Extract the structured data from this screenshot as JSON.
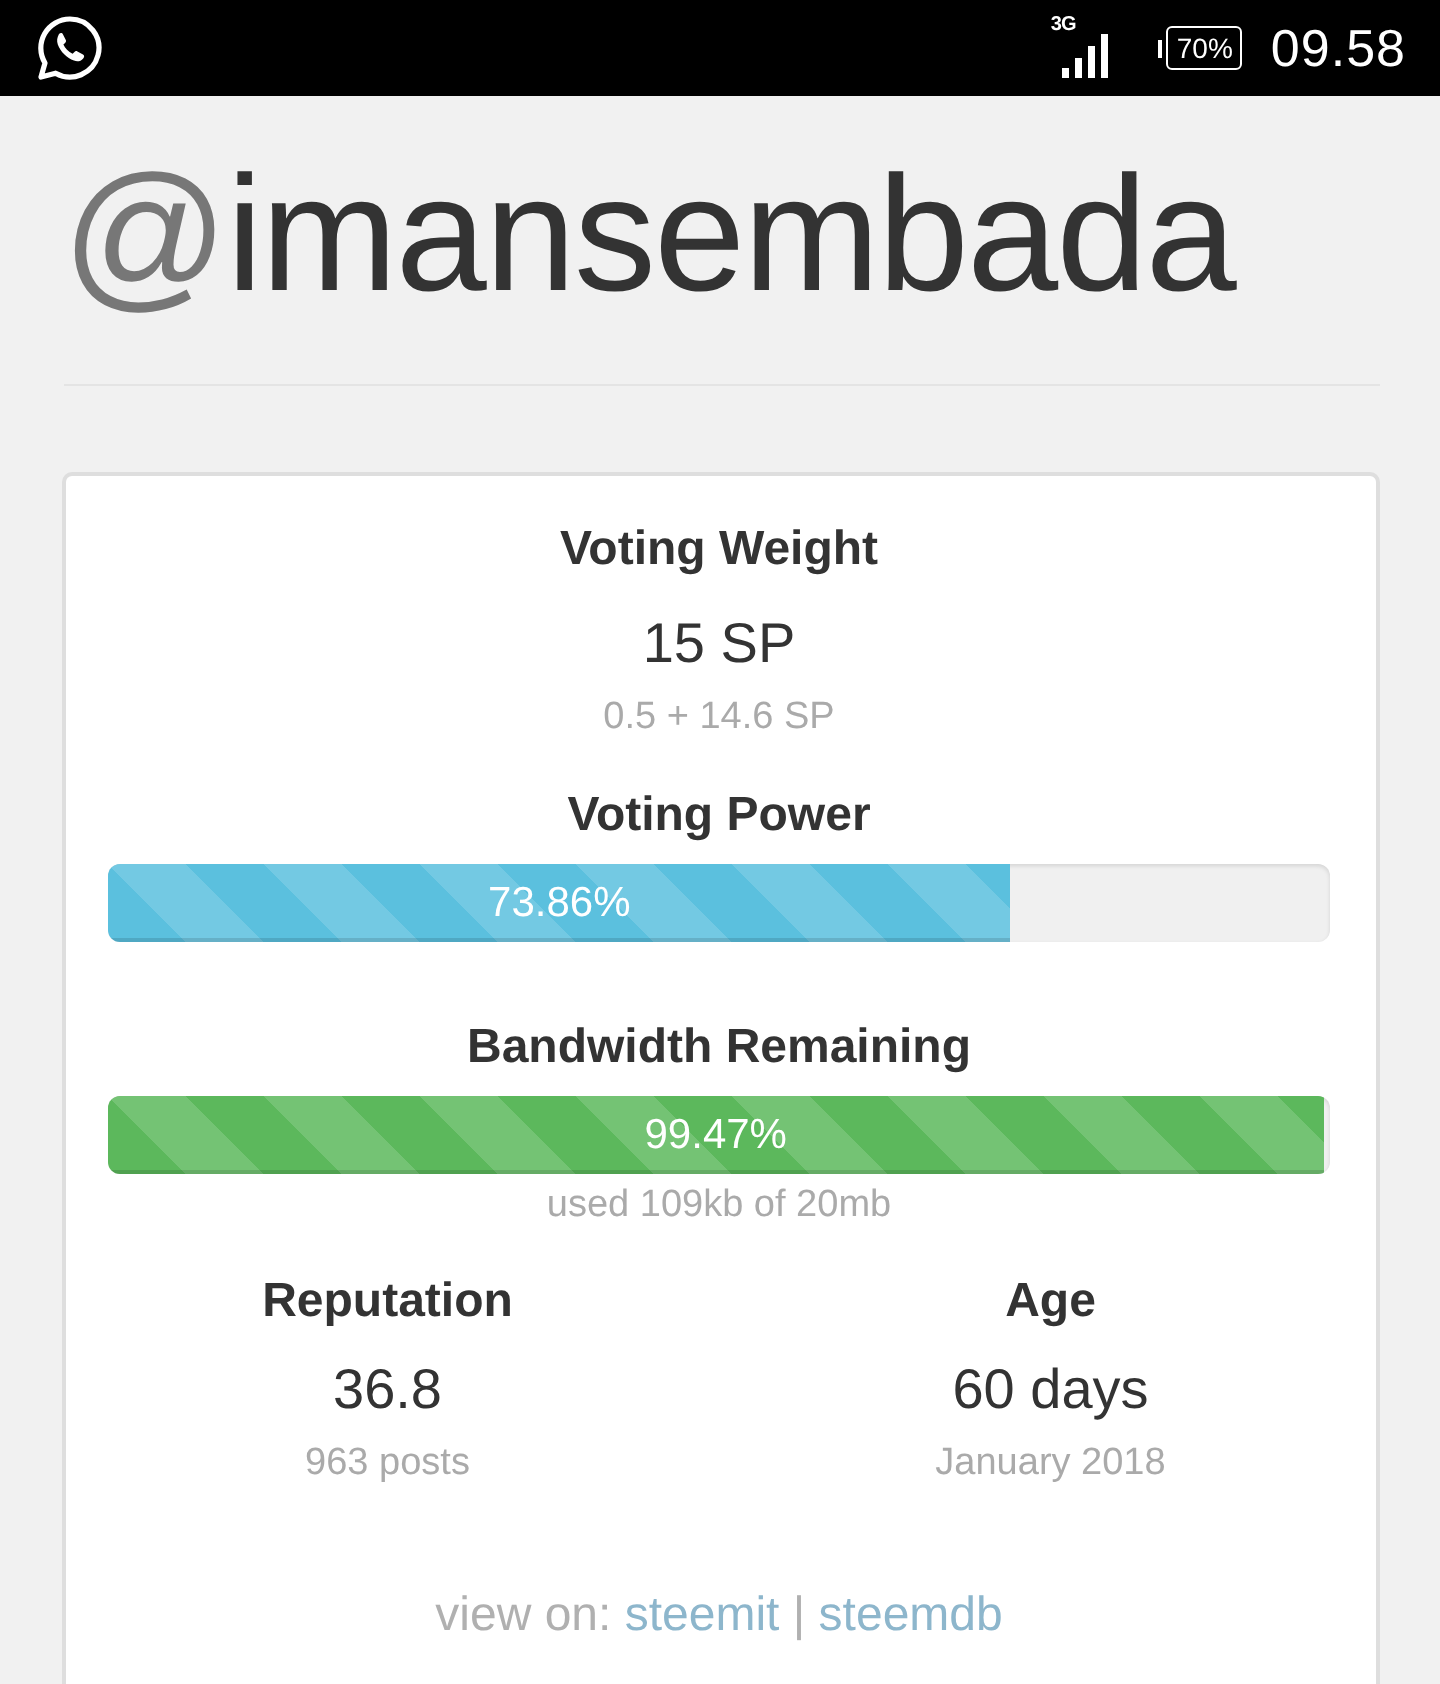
{
  "status_bar": {
    "network": "3G",
    "battery": "70%",
    "time": "09.58"
  },
  "profile": {
    "prefix": "@",
    "username": "imansembada"
  },
  "voting_weight": {
    "title": "Voting Weight",
    "value": "15 SP",
    "detail": "0.5 + 14.6 SP"
  },
  "meters": [
    {
      "title": "Voting Power",
      "level": 0.7386,
      "reading": "73.86%",
      "color": "#5bc0de"
    },
    {
      "title": "Bandwidth Remaining",
      "level": 0.9947,
      "reading": "99.47%",
      "color": "#5cb85c",
      "detail": "used 109kb of 20mb"
    }
  ],
  "stats": [
    {
      "title": "Reputation",
      "value": "36.8",
      "detail": "963 posts"
    },
    {
      "title": "Age",
      "value": "60 days",
      "detail": "January 2018"
    }
  ],
  "footer": {
    "prefix": "view on:",
    "separator": "|",
    "links": [
      {
        "label": "steemit"
      },
      {
        "label": "steemdb"
      }
    ]
  }
}
